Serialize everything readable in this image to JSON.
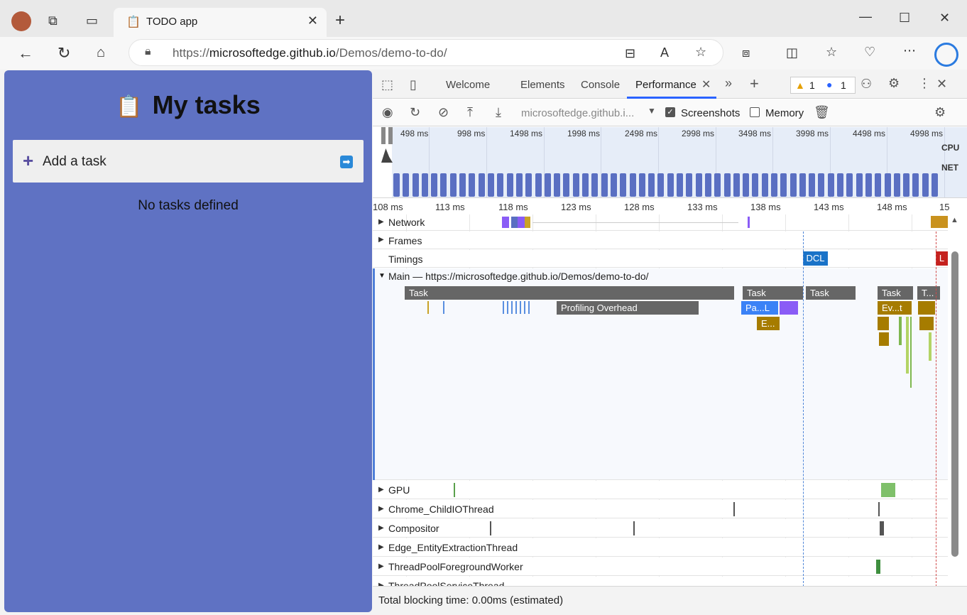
{
  "browser": {
    "tab_title": "TODO app",
    "url_prefix": "https://",
    "url_host": "microsoftedge.github.io",
    "url_path": "/Demos/demo-to-do/"
  },
  "page": {
    "title": "My tasks",
    "add_task_label": "Add a task",
    "empty_message": "No tasks defined"
  },
  "devtools": {
    "tabs": [
      "Welcome",
      "Elements",
      "Console",
      "Performance"
    ],
    "active_tab": "Performance",
    "warnings_count": "1",
    "messages_count": "1",
    "recording_target": "microsoftedge.github.i...",
    "screenshots_label": "Screenshots",
    "screenshots_checked": true,
    "memory_label": "Memory",
    "memory_checked": false,
    "overview_ticks": [
      "498 ms",
      "998 ms",
      "1498 ms",
      "1998 ms",
      "2498 ms",
      "2998 ms",
      "3498 ms",
      "3998 ms",
      "4498 ms",
      "4998 ms"
    ],
    "cpu_label": "CPU",
    "net_label": "NET",
    "ruler_ticks": [
      "108 ms",
      "113 ms",
      "118 ms",
      "123 ms",
      "128 ms",
      "133 ms",
      "138 ms",
      "143 ms",
      "148 ms",
      "15"
    ],
    "tracks": {
      "network": "Network",
      "frames": "Frames",
      "timings": "Timings",
      "main": "Main — https://microsoftedge.github.io/Demos/demo-to-do/",
      "gpu": "GPU",
      "child_io": "Chrome_ChildIOThread",
      "compositor": "Compositor",
      "entity": "Edge_EntityExtractionThread",
      "threadpool_fg": "ThreadPoolForegroundWorker",
      "threadpool_svc": "ThreadPoolServiceThread"
    },
    "markers": {
      "dcl": "DCL",
      "lcp": "L"
    },
    "flame": {
      "task": "Task",
      "task_short": "T...",
      "profiling": "Profiling Overhead",
      "parse": "Pa...L",
      "eval_short": "E...",
      "event": "Ev...t"
    },
    "status_text": "Total blocking time: 0.00ms (estimated)",
    "colors": {
      "accent": "#2962ff",
      "page_bg": "#5f72c3",
      "task": "#666666",
      "scripting": "#a67c00",
      "rendering": "#8a5cf6",
      "painting": "#7fb84f"
    }
  }
}
